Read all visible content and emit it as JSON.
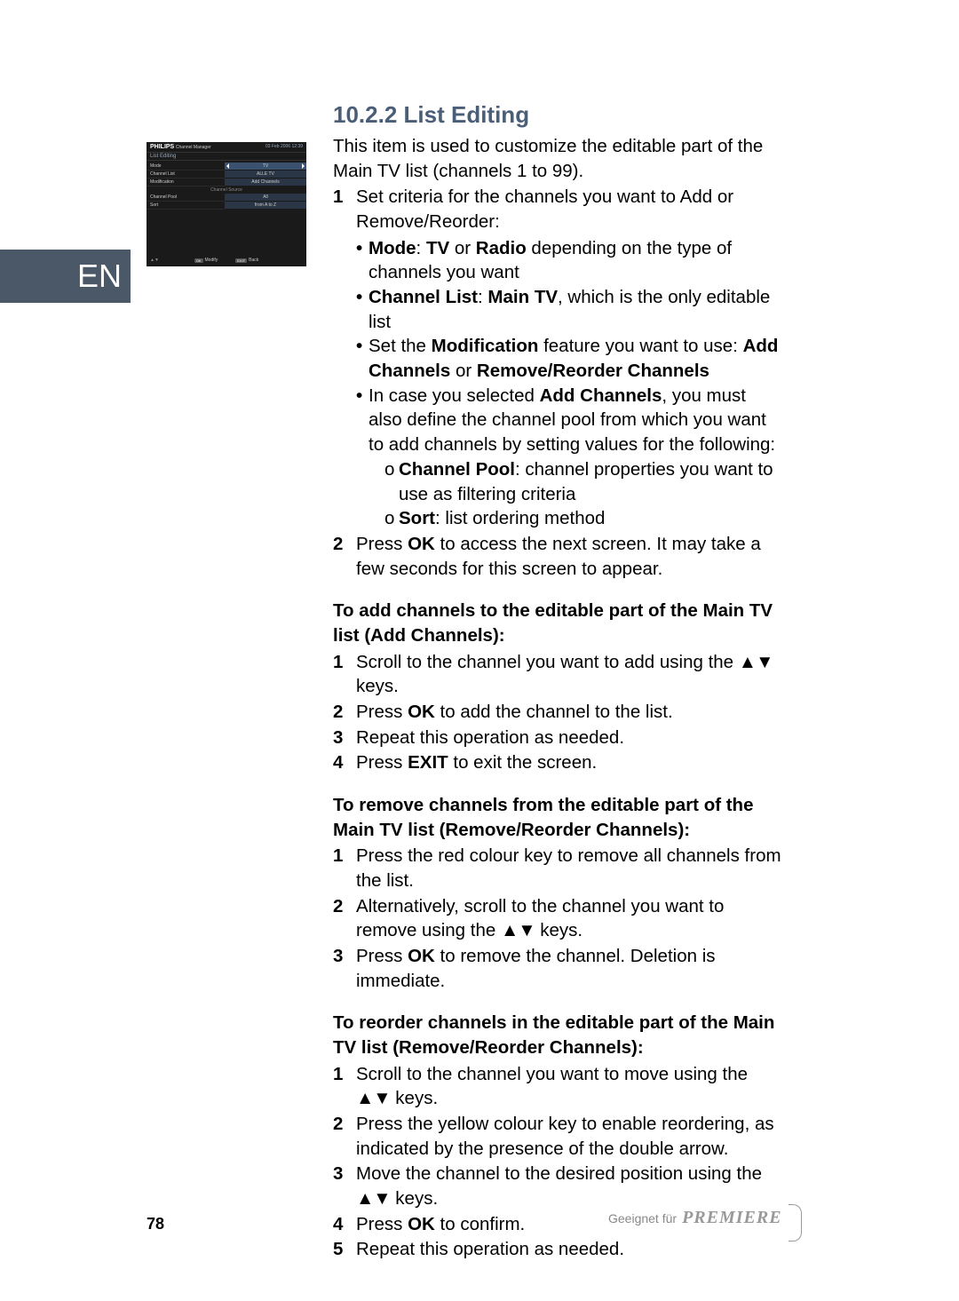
{
  "lang_tab": "EN",
  "page_number": "78",
  "footer": {
    "text": "Geeignet für",
    "logo": "PREMIERE"
  },
  "screenshot": {
    "brand": "PHILIPS",
    "header_sub": "Channel Manager",
    "date": "03 Feb 2006",
    "time": "12:39",
    "title": "List Editing",
    "rows": [
      {
        "label": "Mode",
        "value": "TV",
        "selected": true
      },
      {
        "label": "Channel List",
        "value": "ALLE TV"
      },
      {
        "label": "Modification",
        "value": "Add Channels"
      }
    ],
    "section_header": "Channel Source",
    "rows2": [
      {
        "label": "Channel Pool",
        "value": "All"
      },
      {
        "label": "Sort",
        "value": "from A to Z"
      }
    ],
    "footer_left": "▲▼",
    "footer_actions": [
      {
        "key": "OK",
        "label": "Modify"
      },
      {
        "key": "EXIT",
        "label": "Back"
      }
    ]
  },
  "section": {
    "heading_number": "10.2.2",
    "heading_title": "List Editing",
    "intro": "This item is used to customize the editable part of the Main TV list (channels 1 to 99).",
    "step1_intro": "Set criteria for the channels you want to Add or Remove/Reorder:",
    "bullets": {
      "b1_pre": "Mode",
      "b1_mid": ": ",
      "b1_bold2": "TV",
      "b1_or": " or ",
      "b1_bold3": "Radio",
      "b1_post": " depending on the type of channels you want",
      "b2_pre": "Channel List",
      "b2_mid": ": ",
      "b2_bold2": "Main TV",
      "b2_post": ", which is the only editable list",
      "b3_pre": "Set the ",
      "b3_bold": "Modification",
      "b3_mid": " feature you want to use: ",
      "b3_bold2": "Add Channels",
      "b3_or": " or ",
      "b3_bold3": "Remove/Reorder Channels",
      "b4_pre": "In case you selected ",
      "b4_bold": "Add Channels",
      "b4_post": ", you must also define the channel pool from which you want to add channels by setting values for the following:",
      "sub1_bold": "Channel Pool",
      "sub1_post": ": channel properties you want to use as filtering criteria",
      "sub2_bold": "Sort",
      "sub2_post": ": list ordering method"
    },
    "step2_pre": "Press ",
    "step2_bold": "OK",
    "step2_post": " to access the next screen. It may take a few seconds for this screen to appear.",
    "sub_a_title": "To add channels to the editable part of the Main TV list (Add Channels):",
    "sub_a": {
      "s1": "Scroll to the channel you want to add using the ",
      "s1_post": " keys.",
      "s2_pre": "Press ",
      "s2_bold": "OK",
      "s2_post": " to add the channel to the list.",
      "s3": "Repeat this operation as needed.",
      "s4_pre": "Press ",
      "s4_bold": "EXIT",
      "s4_post": " to exit the screen."
    },
    "sub_b_title": "To remove channels from the editable part of the Main TV list (Remove/Reorder Channels):",
    "sub_b": {
      "s1": "Press the red colour key to remove all channels from the list.",
      "s2_pre": "Alternatively, scroll to the channel you want to remove using the ",
      "s2_post": " keys.",
      "s3_pre": "Press ",
      "s3_bold": "OK",
      "s3_post": " to remove the channel. Deletion is immediate."
    },
    "sub_c_title": "To reorder channels in the editable part of the Main TV list (Remove/Reorder Channels):",
    "sub_c": {
      "s1_pre": "Scroll to the channel you want to move using the ",
      "s1_post": " keys.",
      "s2": "Press the yellow colour key to enable reordering, as indicated by the presence of the double arrow.",
      "s3_pre": "Move the channel to the desired position using the ",
      "s3_post": " keys.",
      "s4_pre": "Press ",
      "s4_bold": "OK",
      "s4_post": " to confirm.",
      "s5": "Repeat this operation as needed."
    },
    "arrow_glyph": "▲▼"
  }
}
